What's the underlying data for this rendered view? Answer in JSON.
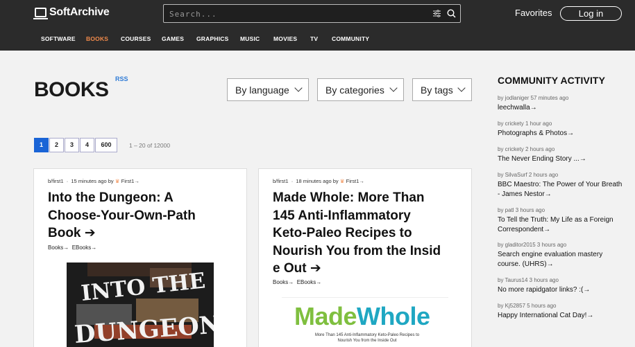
{
  "brand": {
    "name": "SoftArchive"
  },
  "search": {
    "placeholder": "Search..."
  },
  "header": {
    "favorites": "Favorites",
    "login": "Log in"
  },
  "nav": [
    "SOFTWARE",
    "BOOKS",
    "COURSES",
    "GAMES",
    "GRAPHICS",
    "MUSIC",
    "MOVIES",
    "TV",
    "COMMUNITY"
  ],
  "nav_active": "BOOKS",
  "page": {
    "title": "BOOKS",
    "rss": "RSS"
  },
  "filters": [
    "By language",
    "By categories",
    "By tags"
  ],
  "pagination": {
    "pages": [
      "1",
      "2",
      "3",
      "4",
      "600"
    ],
    "current": "1",
    "info": "1 – 20 of 12000"
  },
  "posts": [
    {
      "author": "b/first1",
      "time": "15 minutes ago",
      "by": "by",
      "poster": "First1",
      "title": "Into the Dungeon: A Choose-Your-Own-Path Book",
      "tags": [
        "Books",
        "EBooks"
      ],
      "cover_text": [
        "INTO THE",
        "DUNGEON"
      ]
    },
    {
      "author": "b/first1",
      "time": "18 minutes ago",
      "by": "by",
      "poster": "First1",
      "title": "Made Whole: More Than 145 Anti-Inflammatory Keto-Paleo Recipes to Nourish You from the Insid e Out",
      "tags": [
        "Books",
        "EBooks"
      ],
      "cover_text": [
        "Made",
        "Whole",
        "More Than 145 Anti-Inflammatory Keto-Paleo Recipes to",
        "Nourish You from the Inside Out"
      ]
    }
  ],
  "community": {
    "title": "COMMUNITY ACTIVITY",
    "items": [
      {
        "by": "by jodlaniger 57 minutes ago",
        "text": "leechwalla"
      },
      {
        "by": "by crickety 1 hour ago",
        "text": "Photographs & Photos"
      },
      {
        "by": "by crickety 2 hours ago",
        "text": "The Never Ending Story ..."
      },
      {
        "by": "by SilvaSurf 2 hours ago",
        "text": "BBC Maestro: The Power of Your Breath - James Nestor"
      },
      {
        "by": "by patl 3 hours ago",
        "text": "To Tell the Truth: My Life as a Foreign Correspondent"
      },
      {
        "by": "by gladitor2015 3 hours ago",
        "text": "Search engine evaluation mastery course. (UHRS)"
      },
      {
        "by": "by Taurus14 3 hours ago",
        "text": "No more rapidgator links? :("
      },
      {
        "by": "by Kj52857 5 hours ago",
        "text": "Happy International Cat Day!"
      }
    ]
  },
  "colors": {
    "header_bg": "#2b2b2b",
    "accent": "#f08a4b",
    "pager_active": "#1a64d6",
    "link_blue": "#2f7bd6"
  },
  "icons": [
    "logo-icon",
    "filter-icon",
    "search-icon",
    "chevron-down-icon",
    "arrow-right-icon",
    "crown-icon"
  ]
}
